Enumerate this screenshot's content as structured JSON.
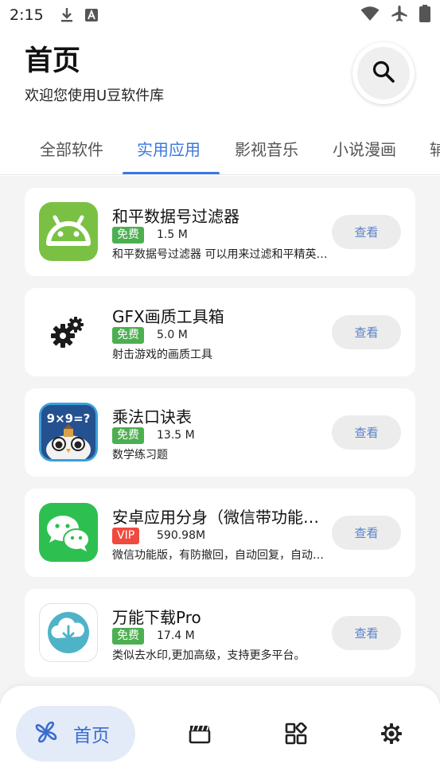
{
  "status_bar": {
    "time": "2:15",
    "icons": [
      "download-icon",
      "text-a-icon",
      "wifi-icon",
      "airplane-icon",
      "battery-icon"
    ]
  },
  "header": {
    "title": "首页",
    "subtitle": "欢迎您使用U豆软件库",
    "search_icon": "search-icon"
  },
  "tabs": [
    {
      "label": "全部软件",
      "active": false
    },
    {
      "label": "实用应用",
      "active": true
    },
    {
      "label": "影视音乐",
      "active": false
    },
    {
      "label": "小说漫画",
      "active": false
    },
    {
      "label": "辅",
      "active": false
    }
  ],
  "apps": [
    {
      "name": "和平数据号过滤器",
      "badge": "免费",
      "badge_color": "#4caf50",
      "size": "1.5 M",
      "description": "和平数据号过滤器 可以用来过滤和平精英数据号",
      "button": "查看",
      "icon": "android-icon"
    },
    {
      "name": "GFX画质工具箱",
      "badge": "免费",
      "badge_color": "#4caf50",
      "size": "5.0 M",
      "description": "射击游戏的画质工具",
      "button": "查看",
      "icon": "gears-icon"
    },
    {
      "name": "乘法口诀表",
      "badge": "免费",
      "badge_color": "#4caf50",
      "size": "13.5 M",
      "description": "数学练习题",
      "button": "查看",
      "icon": "multiplication-owl-icon"
    },
    {
      "name": "安卓应用分身（微信带功能版）",
      "badge": "VIP",
      "badge_color": "#f04a3e",
      "size": "590.98M",
      "description": "微信功能版，有防撤回，自动回复，自动抢红包",
      "button": "查看",
      "icon": "wechat-icon"
    },
    {
      "name": "万能下载Pro",
      "badge": "免费",
      "badge_color": "#4caf50",
      "size": "17.4 M",
      "description": "类似去水印,更加高级，支持更多平台。",
      "button": "查看",
      "icon": "cloud-download-icon"
    }
  ],
  "bottom_nav": {
    "home_label": "首页",
    "items": [
      "pinwheel-icon",
      "clapperboard-icon",
      "apps-grid-icon",
      "settings-gear-icon"
    ]
  },
  "colors": {
    "accent": "#3a78e0",
    "free_badge": "#4caf50",
    "vip_badge": "#f04a3e"
  }
}
